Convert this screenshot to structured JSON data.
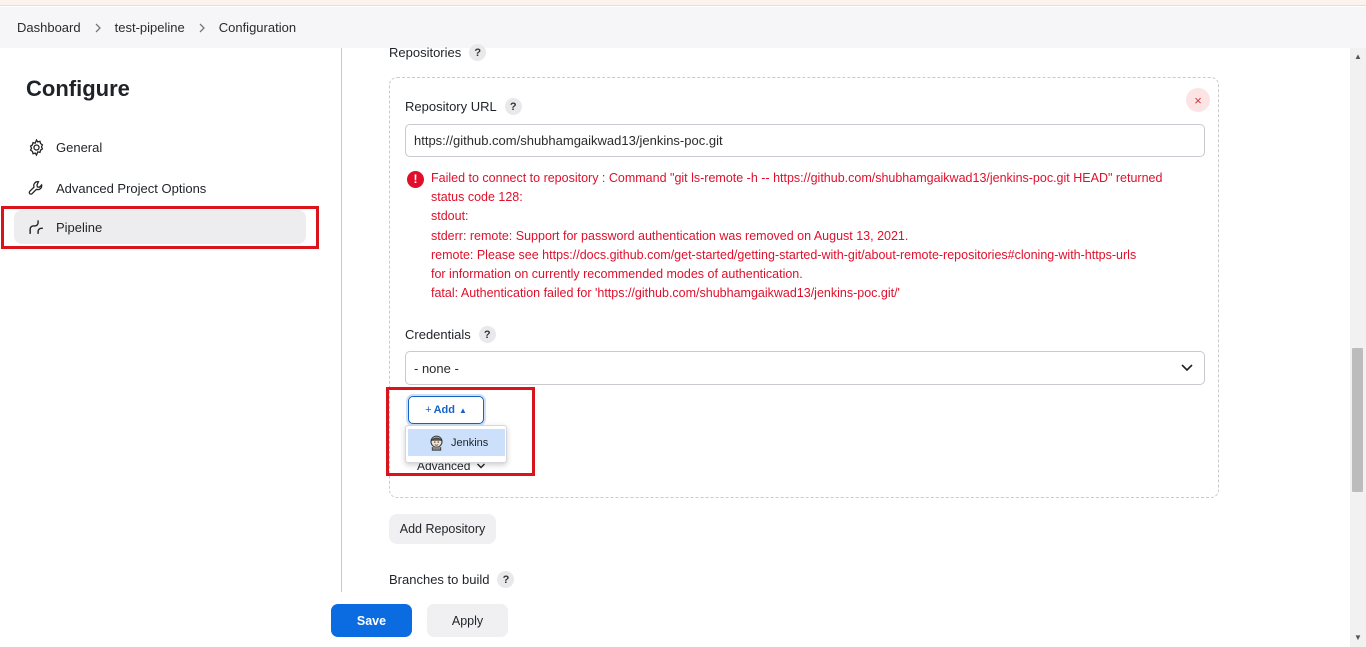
{
  "breadcrumb": [
    "Dashboard",
    "test-pipeline",
    "Configuration"
  ],
  "sidebar": {
    "title": "Configure",
    "items": [
      {
        "label": "General",
        "icon": "gear-icon"
      },
      {
        "label": "Advanced Project Options",
        "icon": "wrench-icon"
      },
      {
        "label": "Pipeline",
        "icon": "pipeline-icon",
        "active": true
      }
    ]
  },
  "repositories": {
    "label": "Repositories",
    "help": "?",
    "close": "×",
    "repo_url_label": "Repository URL",
    "repo_url_value": "https://github.com/shubhamgaikwad13/jenkins-poc.git",
    "error_lines": [
      "Failed to connect to repository : Command \"git ls-remote -h -- https://github.com/shubhamgaikwad13/jenkins-poc.git HEAD\" returned",
      "status code 128:",
      "stdout:",
      "stderr: remote: Support for password authentication was removed on August 13, 2021.",
      "remote: Please see https://docs.github.com/get-started/getting-started-with-git/about-remote-repositories#cloning-with-https-urls",
      "for information on currently recommended modes of authentication.",
      "fatal: Authentication failed for 'https://github.com/shubhamgaikwad13/jenkins-poc.git/'"
    ],
    "credentials_label": "Credentials",
    "credentials_value": "- none -",
    "add_button": "Add",
    "dropdown_item": "Jenkins",
    "advanced_label": "Advanced",
    "add_repository": "Add Repository"
  },
  "branches": {
    "label": "Branches to build"
  },
  "footer": {
    "save": "Save",
    "apply": "Apply"
  },
  "colors": {
    "accent": "#0b6be0",
    "error": "#e0102c",
    "highlight_box": "#d9141b"
  }
}
